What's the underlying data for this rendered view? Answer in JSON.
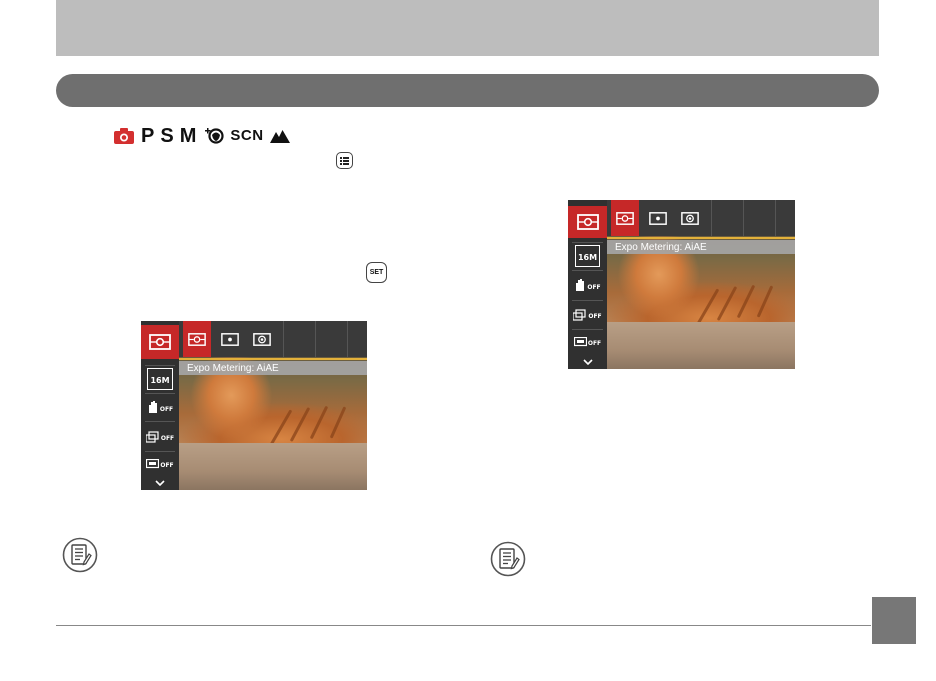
{
  "header": {
    "band_color": "#bdbdbd",
    "section_bar_color": "#6f6f6f"
  },
  "modes": {
    "letters": [
      "P",
      "S",
      "M"
    ],
    "scene_label": "SCN",
    "icons": [
      "camera-auto-icon",
      "portrait-enhance-icon",
      "landscape-icon"
    ]
  },
  "inline_buttons": {
    "menu_button_icon": "menu-button-icon",
    "set_button_label": "SET"
  },
  "screens": {
    "left": {
      "caption": "Expo Metering: AiAE"
    },
    "right": {
      "caption": "Expo Metering: AiAE"
    }
  },
  "side_menu_icons": [
    "metering-icon",
    "resolution-16m-icon",
    "stabilizer-off-icon",
    "continuous-off-icon",
    "hdr-off-icon",
    "chevron-down-icon"
  ],
  "side_menu_labels": [
    "16M",
    "OFF",
    "OFF",
    "OFF"
  ],
  "metering_options": [
    "aiae-icon",
    "spot-icon",
    "center-weighted-icon"
  ],
  "colors": {
    "accent_red": "#c62828",
    "accent_yellow": "#e3b13a",
    "page_badge": "#777777"
  },
  "notes": {
    "icon": "memo-note-icon"
  }
}
